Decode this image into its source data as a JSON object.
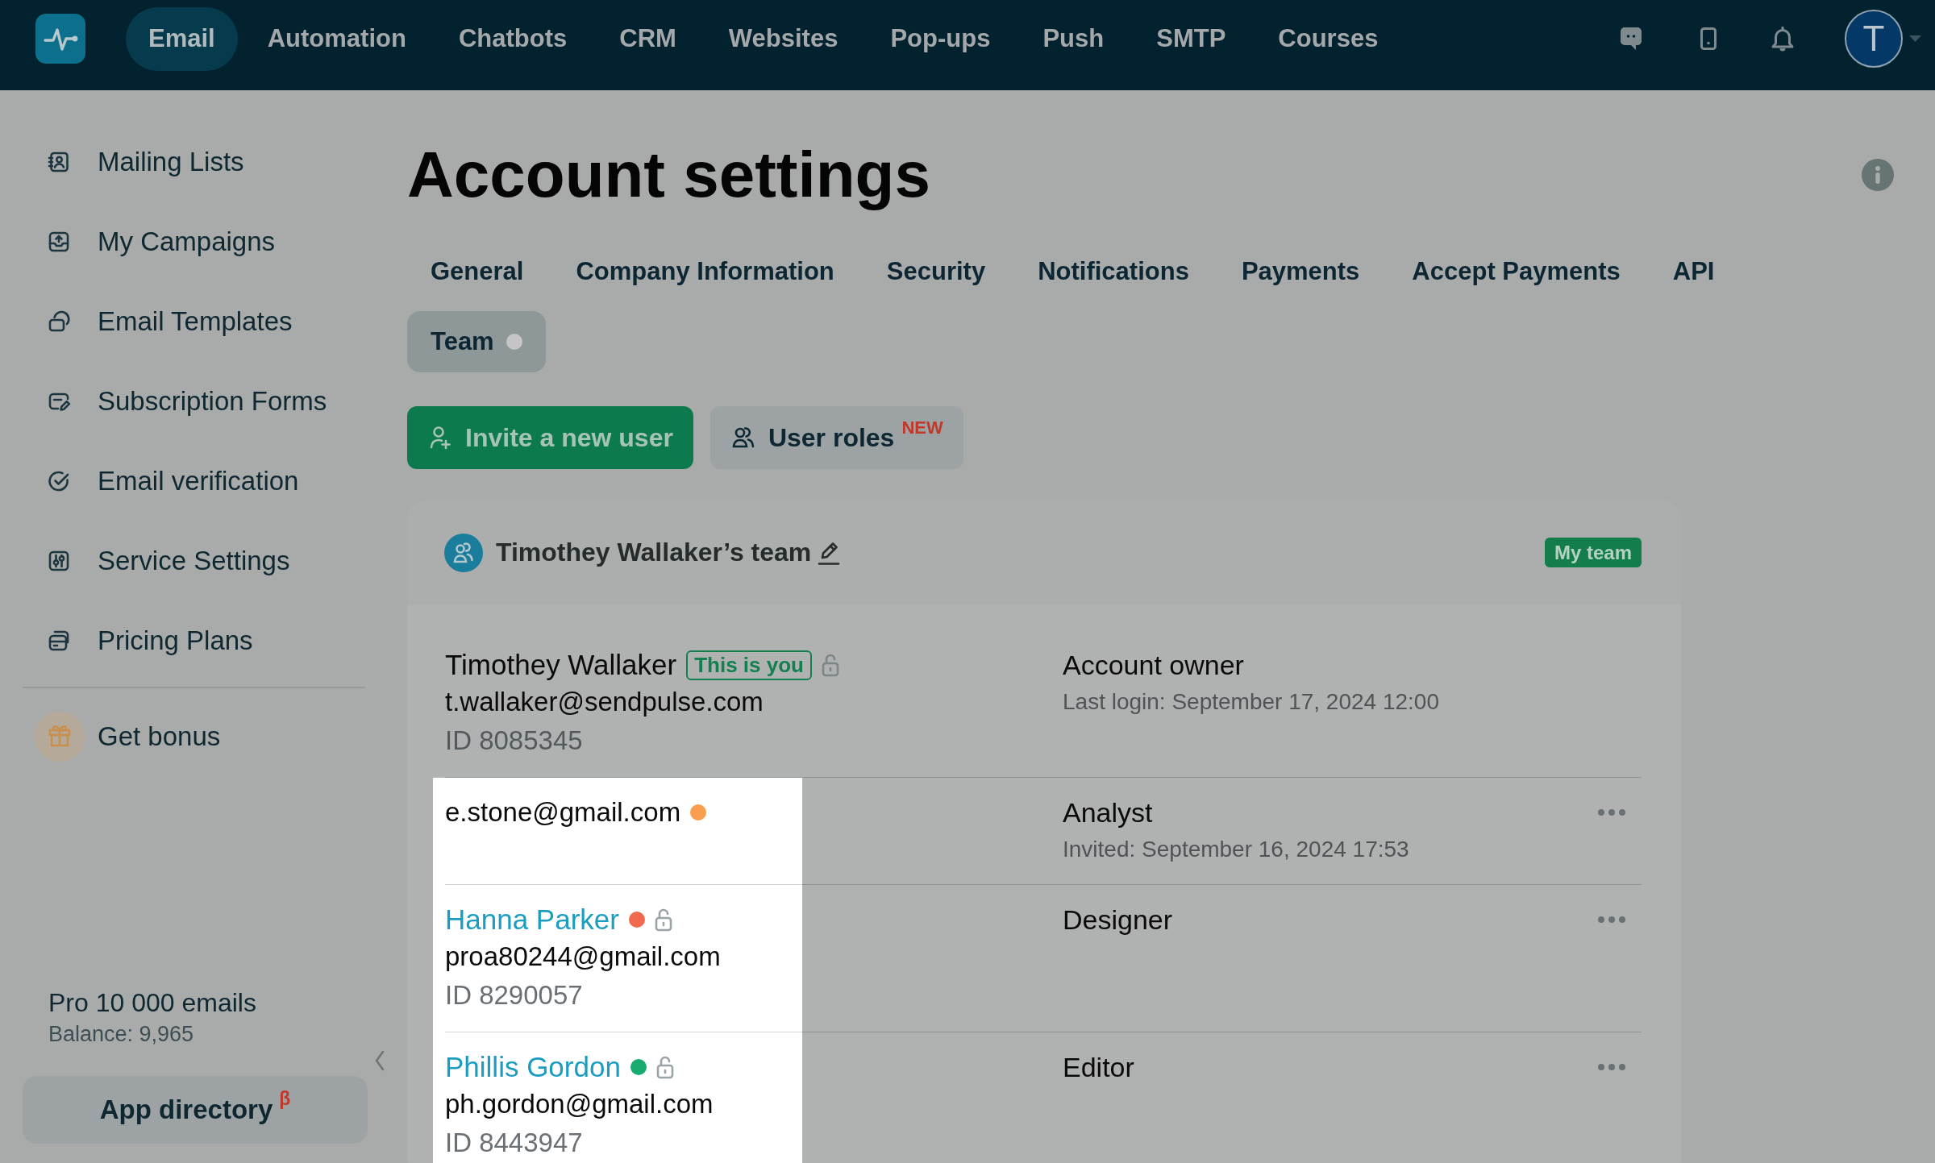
{
  "top_nav": {
    "items": [
      {
        "label": "Email",
        "selected": true
      },
      {
        "label": "Automation",
        "selected": false
      },
      {
        "label": "Chatbots",
        "selected": false
      },
      {
        "label": "CRM",
        "selected": false
      },
      {
        "label": "Websites",
        "selected": false
      },
      {
        "label": "Pop-ups",
        "selected": false
      },
      {
        "label": "Push",
        "selected": false
      },
      {
        "label": "SMTP",
        "selected": false
      },
      {
        "label": "Courses",
        "selected": false
      }
    ],
    "avatar": {
      "initial": "T"
    }
  },
  "sidebar": {
    "items": [
      {
        "label": "Mailing Lists",
        "selected": false
      },
      {
        "label": "My Campaigns",
        "selected": false
      },
      {
        "label": "Email Templates",
        "selected": false
      },
      {
        "label": "Subscription Forms",
        "selected": false
      },
      {
        "label": "Email verification",
        "selected": false
      },
      {
        "label": "Service Settings",
        "selected": false
      },
      {
        "label": "Pricing Plans",
        "selected": false
      }
    ],
    "bonus": {
      "label": "Get bonus"
    },
    "plan": {
      "name": "Pro 10 000 emails",
      "balance": "Balance: 9,965"
    },
    "app_directory": {
      "label": "App directory",
      "badge": "β"
    }
  },
  "page": {
    "title": "Account settings",
    "tabs": [
      {
        "label": "General",
        "selected": false,
        "indicator": false
      },
      {
        "label": "Company Information",
        "selected": false,
        "indicator": false
      },
      {
        "label": "Security",
        "selected": false,
        "indicator": false
      },
      {
        "label": "Notifications",
        "selected": false,
        "indicator": false
      },
      {
        "label": "Payments",
        "selected": false,
        "indicator": false
      },
      {
        "label": "Accept Payments",
        "selected": false,
        "indicator": false
      },
      {
        "label": "API",
        "selected": false,
        "indicator": false
      },
      {
        "label": "Team",
        "selected": true,
        "indicator": true
      }
    ],
    "actions": [
      {
        "label": "Invite a new user",
        "kind": "primary"
      },
      {
        "label": "User roles",
        "kind": "secondary",
        "badge": "NEW"
      }
    ]
  },
  "team": {
    "title": "Timothey Wallaker’s team",
    "badge": "My team",
    "members": [
      {
        "kind": "owner",
        "name": "Timothey Wallaker",
        "you_badge": "This is you",
        "padlock": true,
        "email": "t.wallaker@sendpulse.com",
        "id": "ID 8085345",
        "role": "Account owner",
        "detail": "Last login: September 17, 2024 12:00",
        "highlighted": false
      },
      {
        "kind": "invited",
        "email": "e.stone@gmail.com",
        "color": "#f89e4e",
        "padlock": false,
        "role": "Analyst",
        "detail": "Invited: September 16, 2024 17:53",
        "highlighted": true
      },
      {
        "kind": "member",
        "name": "Hanna Parker",
        "color": "#f2694f",
        "padlock": true,
        "email": "proa80244@gmail.com",
        "id": "ID 8290057",
        "role": "Designer",
        "highlighted": true
      },
      {
        "kind": "member",
        "name": "Phillis Gordon",
        "color": "#18ab6f",
        "padlock": true,
        "email": "ph.gordon@gmail.com",
        "id": "ID 8443947",
        "role": "Editor",
        "highlighted": true
      }
    ]
  }
}
